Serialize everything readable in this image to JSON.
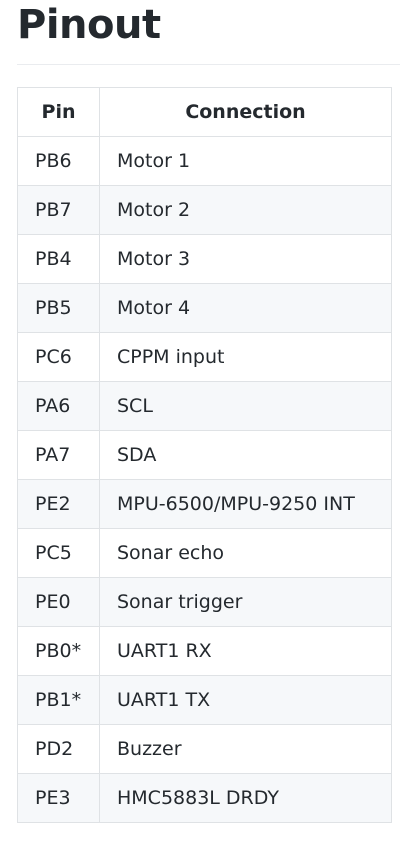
{
  "heading": "Pinout",
  "table": {
    "headers": [
      "Pin",
      "Connection"
    ],
    "rows": [
      {
        "pin": "PB6",
        "connection": "Motor 1"
      },
      {
        "pin": "PB7",
        "connection": "Motor 2"
      },
      {
        "pin": "PB4",
        "connection": "Motor 3"
      },
      {
        "pin": "PB5",
        "connection": "Motor 4"
      },
      {
        "pin": "PC6",
        "connection": "CPPM input"
      },
      {
        "pin": "PA6",
        "connection": "SCL"
      },
      {
        "pin": "PA7",
        "connection": "SDA"
      },
      {
        "pin": "PE2",
        "connection": "MPU-6500/MPU-9250 INT"
      },
      {
        "pin": "PC5",
        "connection": "Sonar echo"
      },
      {
        "pin": "PE0",
        "connection": "Sonar trigger"
      },
      {
        "pin": "PB0*",
        "connection": "UART1 RX"
      },
      {
        "pin": "PB1*",
        "connection": "UART1 TX"
      },
      {
        "pin": "PD2",
        "connection": "Buzzer"
      },
      {
        "pin": "PE3",
        "connection": "HMC5883L DRDY"
      }
    ]
  },
  "colors": {
    "text": "#24292e",
    "border": "#dfe2e5",
    "stripe": "#f6f8fa",
    "rule": "#eaecef"
  }
}
